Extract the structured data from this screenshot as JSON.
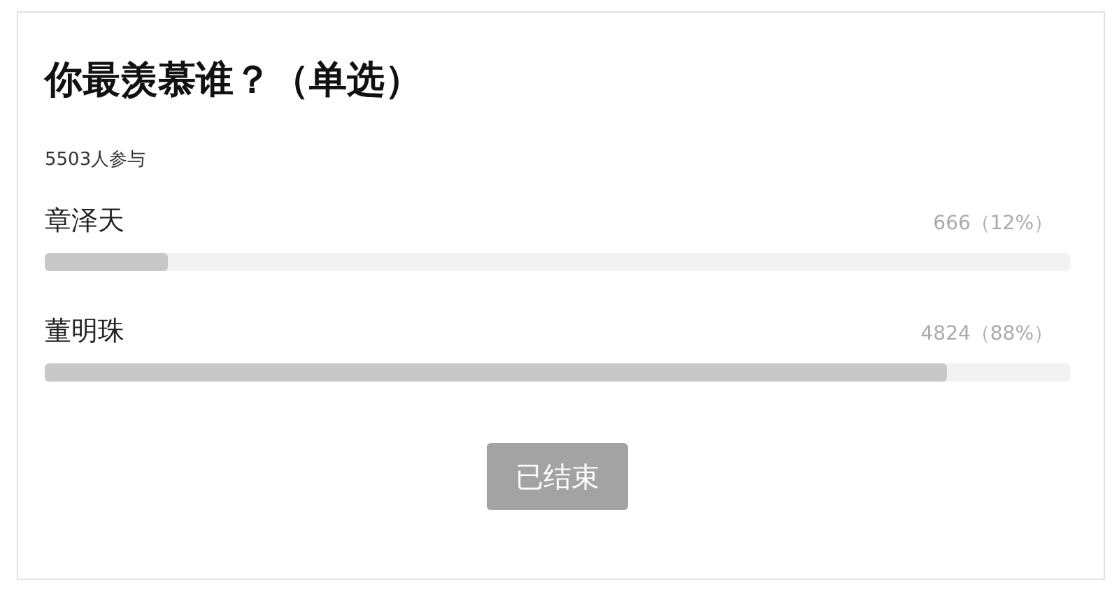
{
  "poll": {
    "title": "你最羡慕谁？（单选）",
    "participants": "5503人参与",
    "options": [
      {
        "name": "章泽天",
        "result": "666（12%）",
        "level": 0.12
      },
      {
        "name": "董明珠",
        "result": "4824（88%）",
        "level": 0.88
      }
    ],
    "button": {
      "label": "已结束",
      "disabled": true
    }
  }
}
